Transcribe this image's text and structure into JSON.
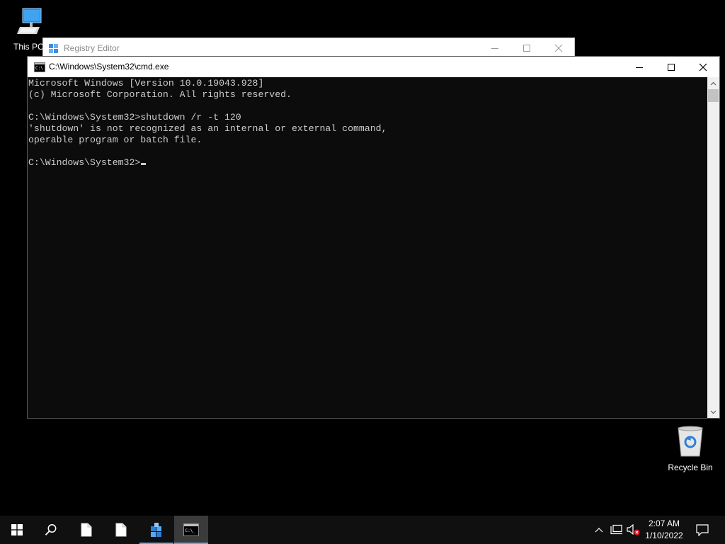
{
  "desktop": {
    "icons": {
      "this_pc": "This PC",
      "recycle_bin": "Recycle Bin"
    }
  },
  "regedit": {
    "title": "Registry Editor",
    "app_icon": "registry-editor-icon"
  },
  "cmd": {
    "title": "C:\\Windows\\System32\\cmd.exe",
    "lines": [
      "Microsoft Windows [Version 10.0.19043.928]",
      "(c) Microsoft Corporation. All rights reserved.",
      "",
      "C:\\Windows\\System32>shutdown /r -t 120",
      "'shutdown' is not recognized as an internal or external command,",
      "operable program or batch file.",
      ""
    ],
    "prompt": "C:\\Windows\\System32>",
    "controls": [
      "minimize",
      "maximize",
      "close"
    ]
  },
  "taskbar": {
    "buttons": [
      "start-icon",
      "search-icon",
      "file-icon",
      "file-icon",
      "registry-editor-icon",
      "command-prompt-icon"
    ],
    "active": "command-prompt-icon",
    "tray": [
      "chevron-up-icon",
      "network-icon",
      "volume-muted-icon"
    ],
    "clock": {
      "time": "2:07 AM",
      "date": "1/10/2022"
    },
    "notification_icon": "notification-icon"
  },
  "colors": {
    "console_bg": "#0c0c0c",
    "console_fg": "#cccccc",
    "taskbar_bg": "#101010",
    "accent": "#6da6d9"
  }
}
